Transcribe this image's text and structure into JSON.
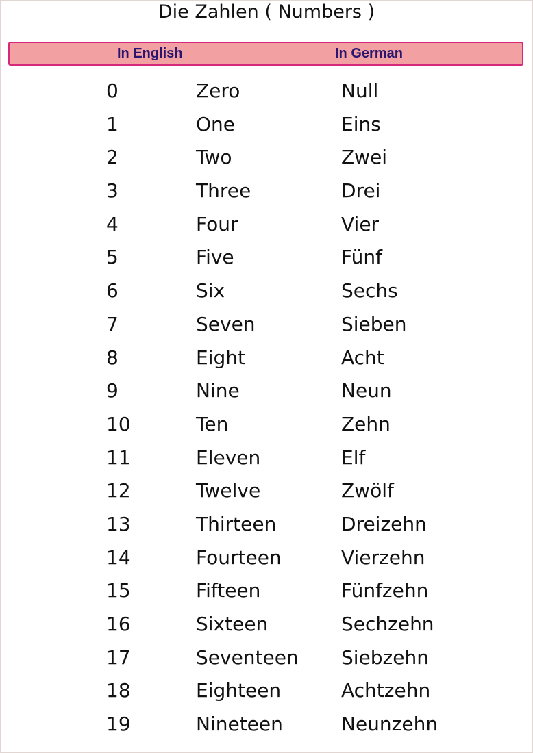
{
  "title": "Die Zahlen ( Numbers )",
  "header": {
    "english_label": "In English",
    "german_label": "In German"
  },
  "colors": {
    "header_fill": "#f2a0a2",
    "header_border": "#d6287a",
    "header_text": "#2a1670"
  },
  "rows": [
    {
      "num": "0",
      "en": "Zero",
      "de": "Null"
    },
    {
      "num": "1",
      "en": "One",
      "de": "Eins"
    },
    {
      "num": "2",
      "en": "Two",
      "de": "Zwei"
    },
    {
      "num": "3",
      "en": "Three",
      "de": "Drei"
    },
    {
      "num": "4",
      "en": "Four",
      "de": "Vier"
    },
    {
      "num": "5",
      "en": "Five",
      "de": "Fünf"
    },
    {
      "num": "6",
      "en": "Six",
      "de": "Sechs"
    },
    {
      "num": "7",
      "en": "Seven",
      "de": "Sieben"
    },
    {
      "num": "8",
      "en": "Eight",
      "de": "Acht"
    },
    {
      "num": "9",
      "en": "Nine",
      "de": "Neun"
    },
    {
      "num": "10",
      "en": "Ten",
      "de": "Zehn"
    },
    {
      "num": "11",
      "en": "Eleven",
      "de": "Elf"
    },
    {
      "num": "12",
      "en": "Twelve",
      "de": "Zwölf"
    },
    {
      "num": "13",
      "en": "Thirteen",
      "de": "Dreizehn"
    },
    {
      "num": "14",
      "en": "Fourteen",
      "de": "Vierzehn"
    },
    {
      "num": "15",
      "en": "Fifteen",
      "de": "Fünfzehn"
    },
    {
      "num": "16",
      "en": "Sixteen",
      "de": "Sechzehn"
    },
    {
      "num": "17",
      "en": "Seventeen",
      "de": "Siebzehn"
    },
    {
      "num": "18",
      "en": "Eighteen",
      "de": "Achtzehn"
    },
    {
      "num": "19",
      "en": "Nineteen",
      "de": "Neunzehn"
    }
  ]
}
